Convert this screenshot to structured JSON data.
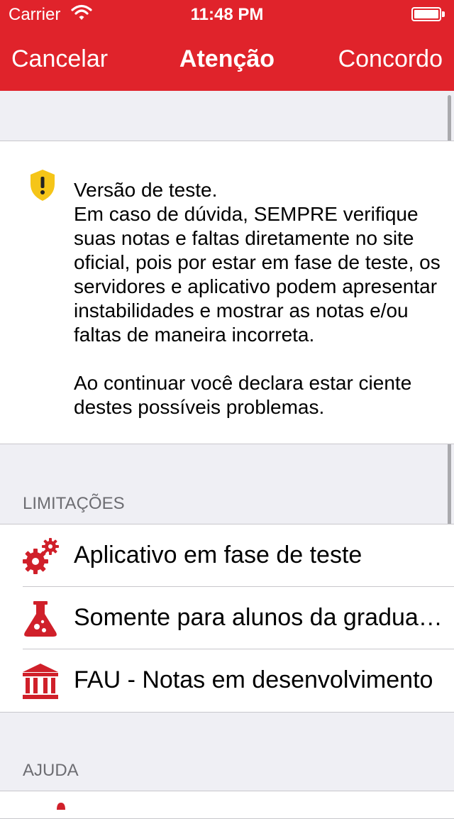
{
  "status_bar": {
    "carrier": "Carrier",
    "time": "11:48 PM"
  },
  "nav": {
    "cancel_label": "Cancelar",
    "title": "Atenção",
    "agree_label": "Concordo"
  },
  "warning": {
    "icon": "shield-warning-icon",
    "text": "Versão de teste.\nEm caso de dúvida, SEMPRE verifique suas notas e faltas diretamente no site oficial, pois por estar em fase de teste, os servidores e aplicativo podem apresentar instabilidades e mostrar as notas e/ou faltas de maneira incorreta.\n\nAo continuar você declara estar ciente destes possíveis problemas."
  },
  "limitations": {
    "header": "LIMITAÇÕES",
    "items": [
      {
        "icon": "gears-icon",
        "label": "Aplicativo em fase de teste"
      },
      {
        "icon": "flask-icon",
        "label": "Somente para alunos da graduação"
      },
      {
        "icon": "institution-icon",
        "label": "FAU - Notas em desenvolvimento"
      }
    ]
  },
  "help": {
    "header": "AJUDA"
  },
  "colors": {
    "brand": "#e0232b",
    "warning": "#f5c518",
    "background": "#efeff4"
  }
}
